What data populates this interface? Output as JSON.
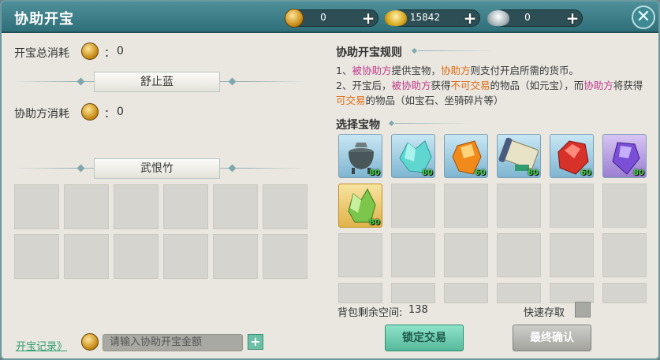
{
  "window": {
    "title": "协助开宝"
  },
  "currencies": [
    {
      "value": "0",
      "icon": "gold-coin-icon"
    },
    {
      "value": "15842",
      "icon": "gold-ingot-icon"
    },
    {
      "value": "0",
      "icon": "silver-ingot-icon"
    }
  ],
  "left": {
    "total_cost_label": "开宝总消耗",
    "total_cost_sep": "：",
    "total_cost_value": "0",
    "player1_name": "舒止蓝",
    "helper_cost_label": "协助方消耗",
    "helper_cost_sep": "：",
    "helper_cost_value": "0",
    "player2_name": "武恨竹",
    "record_link": "开宝记录》",
    "amount_placeholder": "请输入协助开宝金额",
    "add_label": "+"
  },
  "right": {
    "rules_title": "协助开宝规则",
    "rule1": [
      "1、",
      "被协助方",
      "提供宝物，",
      "协助方",
      "则支付开启所需的货币。"
    ],
    "rule2": [
      "2、开宝后，",
      "被协助方",
      "获得",
      "不可交易",
      "的物品（如元宝），而",
      "协助方",
      "将获得",
      "可交易",
      "的物品（如宝石、坐骑碎片等）"
    ],
    "select_title": "选择宝物",
    "items": [
      {
        "name": "cauldron-item",
        "count": "80"
      },
      {
        "name": "teal-crystal-item",
        "count": "80"
      },
      {
        "name": "orange-gem-item",
        "count": "60"
      },
      {
        "name": "scroll-item",
        "count": "80"
      },
      {
        "name": "red-gem-item",
        "count": "60"
      },
      {
        "name": "purple-gem-item",
        "count": "80"
      },
      {
        "name": "green-crystal-item",
        "count": "80"
      }
    ],
    "bag_space_label": "背包剩余空间:",
    "bag_space_value": "138",
    "quick_store_label": "快速存取",
    "lock_button": "锁定交易",
    "confirm_button": "最终确认"
  },
  "colors": {
    "accent": "#3d8a93",
    "lock": "#6fcdb3",
    "confirm": "#b8b8b4"
  }
}
